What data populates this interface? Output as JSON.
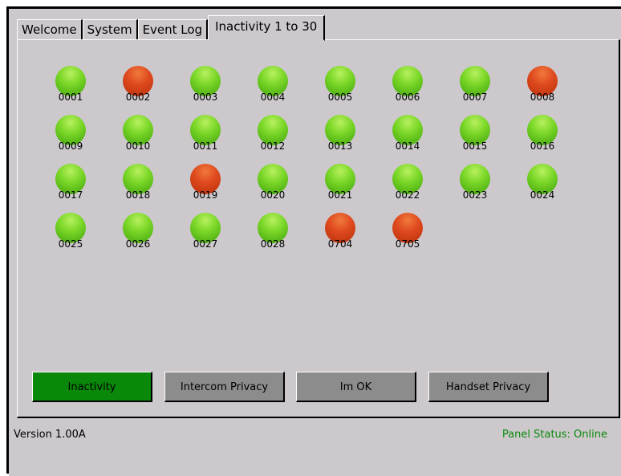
{
  "tabs": [
    {
      "label": "Welcome",
      "active": false
    },
    {
      "label": "System",
      "active": false
    },
    {
      "label": "Event Log",
      "active": false
    },
    {
      "label": "Inactivity 1 to 30",
      "active": true
    }
  ],
  "indicators": [
    {
      "label": "0001",
      "status": "green"
    },
    {
      "label": "0002",
      "status": "red"
    },
    {
      "label": "0003",
      "status": "green"
    },
    {
      "label": "0004",
      "status": "green"
    },
    {
      "label": "0005",
      "status": "green"
    },
    {
      "label": "0006",
      "status": "green"
    },
    {
      "label": "0007",
      "status": "green"
    },
    {
      "label": "0008",
      "status": "red"
    },
    {
      "label": "0009",
      "status": "green"
    },
    {
      "label": "0010",
      "status": "green"
    },
    {
      "label": "0011",
      "status": "green"
    },
    {
      "label": "0012",
      "status": "green"
    },
    {
      "label": "0013",
      "status": "green"
    },
    {
      "label": "0014",
      "status": "green"
    },
    {
      "label": "0015",
      "status": "green"
    },
    {
      "label": "0016",
      "status": "green"
    },
    {
      "label": "0017",
      "status": "green"
    },
    {
      "label": "0018",
      "status": "green"
    },
    {
      "label": "0019",
      "status": "red"
    },
    {
      "label": "0020",
      "status": "green"
    },
    {
      "label": "0021",
      "status": "green"
    },
    {
      "label": "0022",
      "status": "green"
    },
    {
      "label": "0023",
      "status": "green"
    },
    {
      "label": "0024",
      "status": "green"
    },
    {
      "label": "0025",
      "status": "green"
    },
    {
      "label": "0026",
      "status": "green"
    },
    {
      "label": "0027",
      "status": "green"
    },
    {
      "label": "0028",
      "status": "green"
    },
    {
      "label": "0704",
      "status": "red"
    },
    {
      "label": "0705",
      "status": "red"
    }
  ],
  "buttons": [
    {
      "label": "Inactivity",
      "active": true
    },
    {
      "label": "Intercom Privacy",
      "active": false
    },
    {
      "label": "Im OK",
      "active": false
    },
    {
      "label": "Handset Privacy",
      "active": false
    }
  ],
  "status_bar": {
    "version": "Version 1.00A",
    "panel_status": "Panel Status: Online"
  },
  "colors": {
    "background": "#ccc8cc",
    "indicator_ok": "#66cc22",
    "indicator_alarm": "#d9441a",
    "active_button": "#0a880a",
    "inactive_button": "#8c8c8c",
    "online_text": "#0b8a0b"
  }
}
